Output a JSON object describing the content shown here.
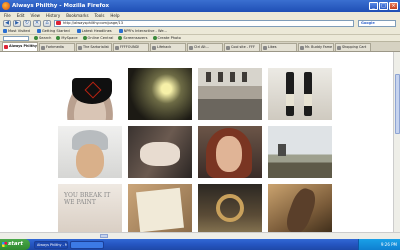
{
  "window": {
    "title": "Always Philthy - Mozilla Firefox"
  },
  "menu": [
    "File",
    "Edit",
    "View",
    "History",
    "Bookmarks",
    "Tools",
    "Help"
  ],
  "nav": {
    "url": "http://alwaysphilthy.com/page/13",
    "search_engine": "Google"
  },
  "bookmarks": [
    "Most Visited",
    "Getting Started",
    "Latest Headlines",
    "NPR's Interactive - We..."
  ],
  "toolbar2": {
    "items": [
      "Search",
      "MySpace",
      "Online Central",
      "Screensavers",
      "Create Photo"
    ]
  },
  "tabs": [
    {
      "label": "Always Philthy",
      "active": true
    },
    {
      "label": "Forkmedia",
      "active": false
    },
    {
      "label": "The Sartorialist",
      "active": false
    },
    {
      "label": "FFFFOUND!",
      "active": false
    },
    {
      "label": "Lifehack",
      "active": false
    },
    {
      "label": "Ctrl Alt...",
      "active": false
    },
    {
      "label": "Cool site - FFF",
      "active": false
    },
    {
      "label": "Likes",
      "active": false
    },
    {
      "label": "Mr. Buddy Fame",
      "active": false
    },
    {
      "label": "Shopping Cart",
      "active": false
    }
  ],
  "gallery": {
    "photos": [
      {
        "name": "photo-black-underwear"
      },
      {
        "name": "photo-light-installation"
      },
      {
        "name": "photo-street-building"
      },
      {
        "name": "photo-markers"
      },
      {
        "name": "photo-girl-cap"
      },
      {
        "name": "photo-reclining-woman"
      },
      {
        "name": "photo-redhead-portrait"
      },
      {
        "name": "photo-landscape"
      },
      {
        "name": "photo-handwriting"
      },
      {
        "name": "photo-notebook"
      },
      {
        "name": "photo-peace-ring"
      },
      {
        "name": "photo-dancer"
      }
    ],
    "handwriting_text": "YOU BREAK IT WE PAINT"
  },
  "taskbar": {
    "start": "start",
    "tasks": [
      {
        "label": "Always Philthy - Mozill...",
        "active": true
      },
      {
        "label": "",
        "active": false
      }
    ],
    "clock": "9:26 PM"
  },
  "colors": {
    "titlebar": "#2457c6",
    "taskbar": "#2555c0",
    "start": "#2f8a2f"
  }
}
